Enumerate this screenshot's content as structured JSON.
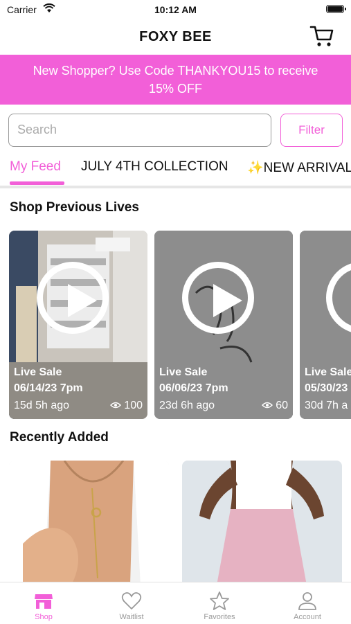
{
  "status_bar": {
    "carrier": "Carrier",
    "time": "10:12 AM"
  },
  "header": {
    "title": "FOXY BEE",
    "cart_icon": "cart-icon"
  },
  "promo": {
    "line1": "New Shopper? Use Code THANKYOU15 to receive",
    "line2": "15% OFF"
  },
  "search": {
    "placeholder": "Search",
    "filter_label": "Filter"
  },
  "tabs": [
    {
      "label": "My Feed",
      "active": true
    },
    {
      "label": "JULY 4TH COLLECTION",
      "active": false
    },
    {
      "label": "✨NEW ARRIVAL",
      "active": false
    }
  ],
  "sections": {
    "previous_lives": "Shop Previous Lives",
    "recently_added": "Recently Added"
  },
  "live_sales": [
    {
      "label": "Live Sale",
      "date": "06/14/23 7pm",
      "ago": "15d 5h ago",
      "views": "100"
    },
    {
      "label": "Live Sale",
      "date": "06/06/23 7pm",
      "ago": "23d 6h ago",
      "views": "60"
    },
    {
      "label": "Live Sale",
      "date": "05/30/23",
      "ago": "30d 7h a",
      "views": ""
    }
  ],
  "bottom_nav": [
    {
      "label": "Shop",
      "icon": "shop-icon",
      "active": true
    },
    {
      "label": "Waitlist",
      "icon": "heart-icon",
      "active": false
    },
    {
      "label": "Favorites",
      "icon": "star-icon",
      "active": false
    },
    {
      "label": "Account",
      "icon": "user-icon",
      "active": false
    }
  ],
  "colors": {
    "accent": "#f25fd8",
    "inactive": "#999999"
  }
}
